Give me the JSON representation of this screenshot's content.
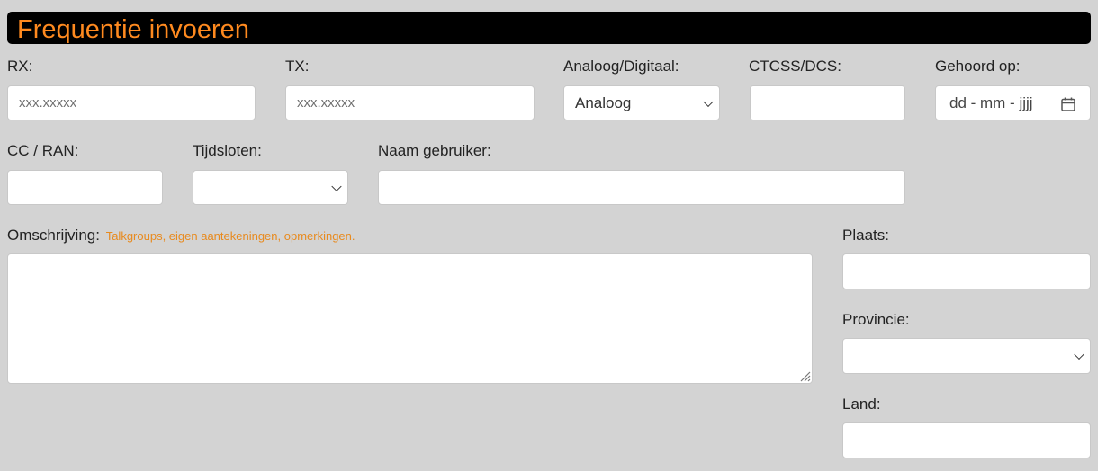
{
  "header": {
    "title": "Frequentie invoeren"
  },
  "fields": {
    "rx": {
      "label": "RX:",
      "placeholder": "xxx.xxxxx"
    },
    "tx": {
      "label": "TX:",
      "placeholder": "xxx.xxxxx"
    },
    "mode": {
      "label": "Analoog/Digitaal:",
      "value": "Analoog"
    },
    "ctcss": {
      "label": "CTCSS/DCS:"
    },
    "heard": {
      "label": "Gehoord op:",
      "value": "dd - mm - jjjj"
    },
    "cc_ran": {
      "label": "CC / RAN:"
    },
    "timeslots": {
      "label": "Tijdsloten:",
      "value": ""
    },
    "user_name": {
      "label": "Naam gebruiker:"
    },
    "description": {
      "label": "Omschrijving:",
      "hint": "Talkgroups, eigen aantekeningen, opmerkingen."
    },
    "place": {
      "label": "Plaats:"
    },
    "province": {
      "label": "Provincie:",
      "value": ""
    },
    "country": {
      "label": "Land:"
    }
  }
}
